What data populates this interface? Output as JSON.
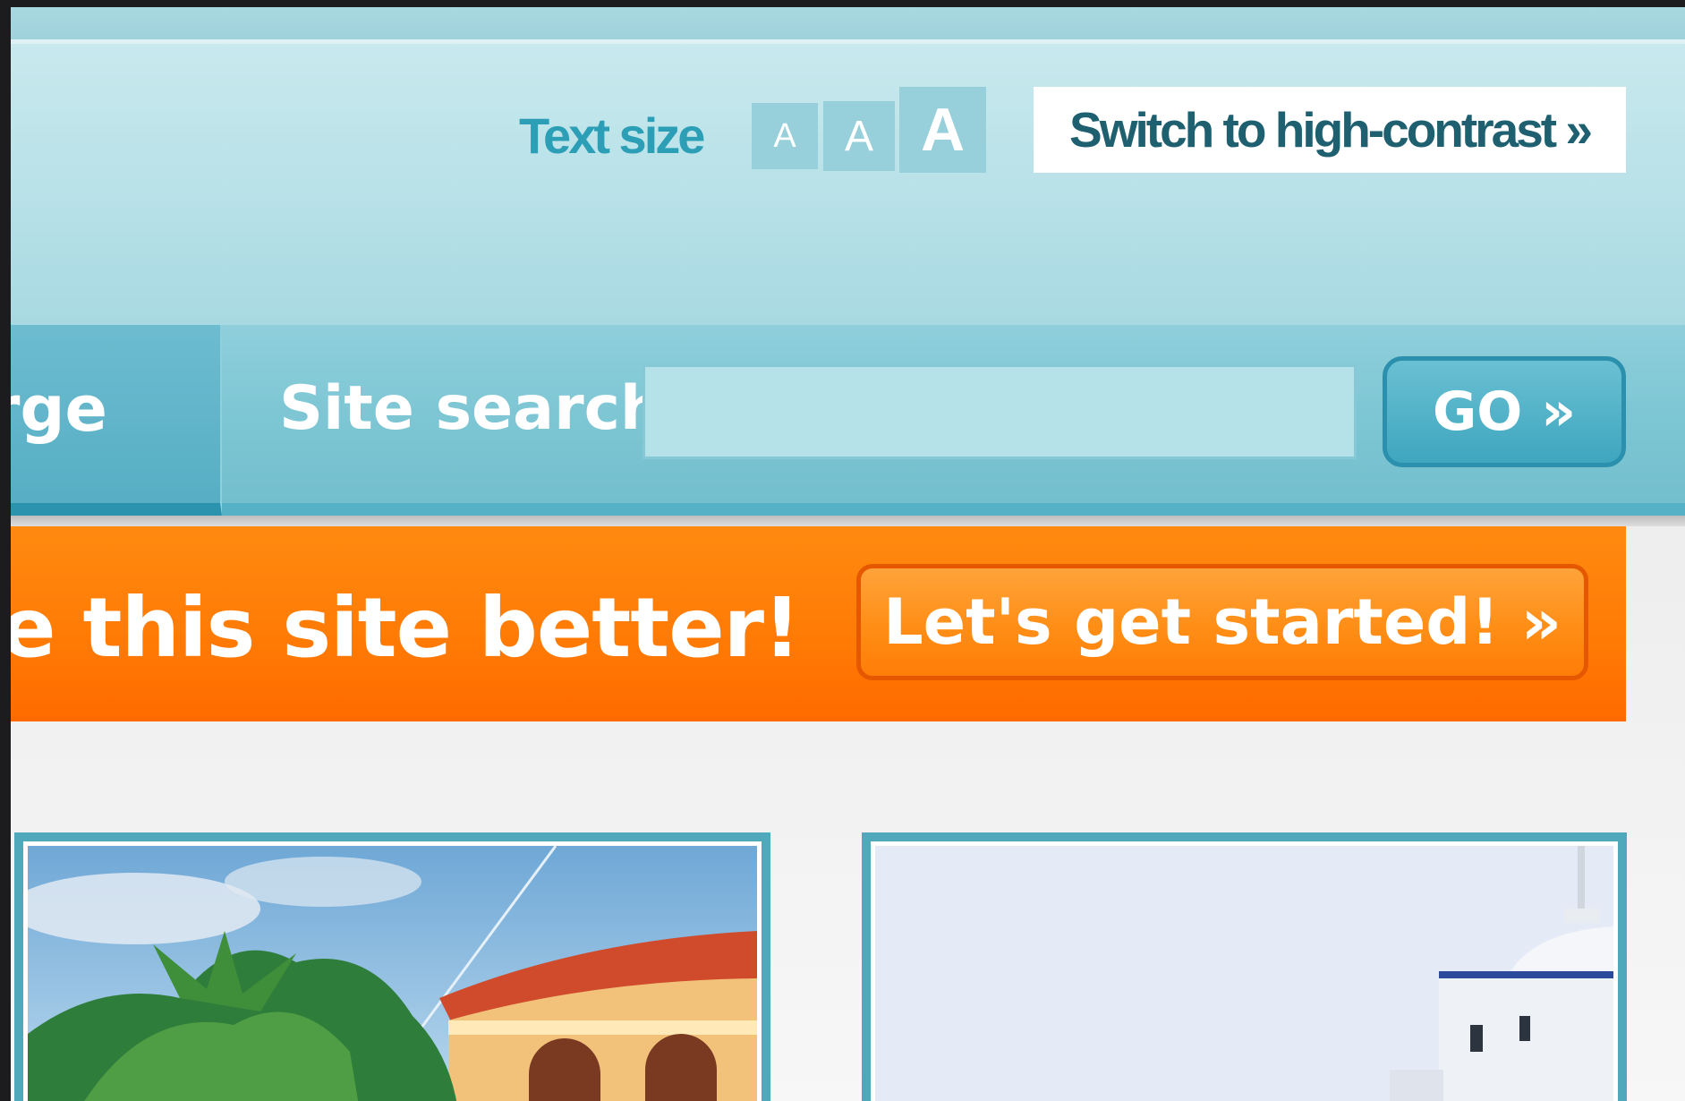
{
  "header": {
    "text_size_label": "Text size",
    "text_size_small": "A",
    "text_size_medium": "A",
    "text_size_large": "A",
    "high_contrast_label": "Switch to high-contrast »"
  },
  "nav": {
    "partial_tab_label": "rge",
    "search_label": "Site search",
    "search_value": "",
    "go_label": "GO »"
  },
  "promo": {
    "text": "nake this site better!",
    "button_label": "Let's get started! »"
  },
  "photos": [
    {
      "subject": "villa with palm trees and terracotta roof"
    },
    {
      "subject": "white building with tower against pale sky"
    }
  ],
  "colors": {
    "header_bg": "#c8e9ee",
    "nav_bg": "#7ec6d4",
    "accent_teal": "#2c9fb7",
    "promo_orange": "#ff7a05"
  }
}
